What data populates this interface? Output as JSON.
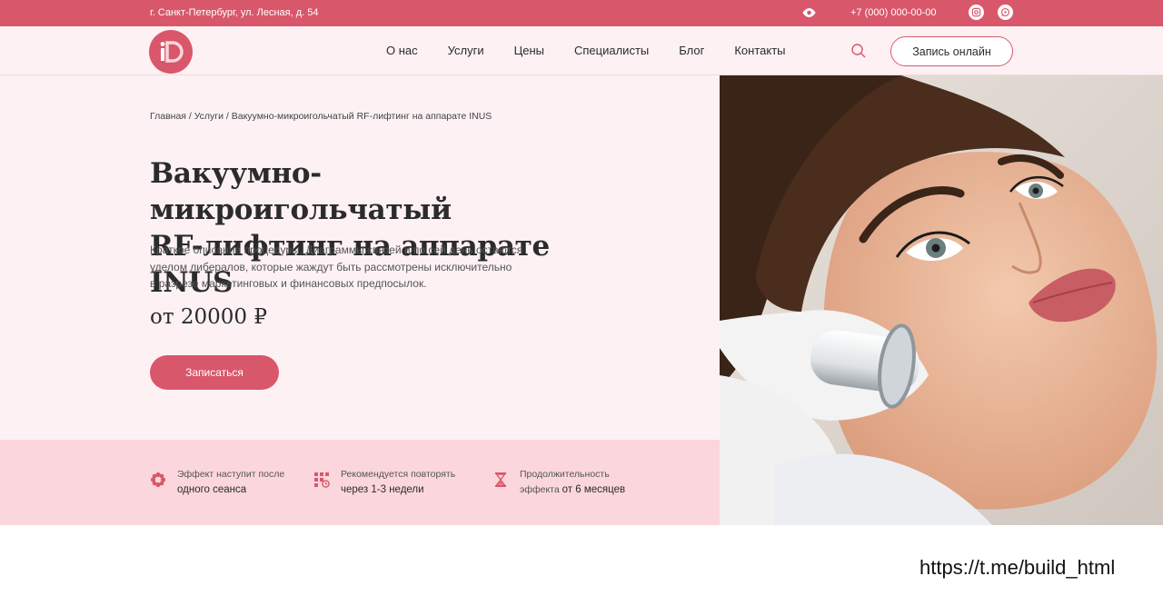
{
  "topbar": {
    "address": "г. Санкт-Петербург, ул. Лесная, д. 54",
    "phone": "+7 (000) 000-00-00",
    "icons": [
      "eye-icon",
      "instagram-icon",
      "whatsapp-icon"
    ]
  },
  "nav": {
    "logo": "iD",
    "items": [
      "О нас",
      "Услуги",
      "Цены",
      "Специалисты",
      "Блог",
      "Контакты"
    ],
    "book_label": "Запись онлайн"
  },
  "hero": {
    "breadcrumb": "Главная / Услуги / Вакуумно-микроигольчатый RF-лифтинг на аппарате INUS",
    "title_line1": "Вакуумно-микроигольчатый",
    "title_line2": "RF-лифтинг на аппарате INUS",
    "desc_line1": "Краткое описание процедуры. Диаграммы связей и по сей день остаются",
    "desc_line2": "уделом либералов, которые жаждут быть рассмотрены исключительно",
    "desc_line3": "в разрезе маркетинговых и финансовых предпосылок.",
    "price": "от 20000 ₽",
    "cta_label": "Записаться"
  },
  "features": [
    {
      "line1": "Эффект наступит после",
      "line2": "одного сеанса",
      "icon": "flower-icon"
    },
    {
      "line1": "Рекомендуется повторять",
      "line2": "через 1-3 недели",
      "icon": "calendar-icon"
    },
    {
      "line1": "Продолжительность",
      "line2_prefix": "эффекта",
      "line2": "от 6 месяцев",
      "icon": "hourglass-icon"
    }
  ],
  "watermark": "https://t.me/build_html",
  "colors": {
    "accent": "#d9576b",
    "light_pink": "#fdf1f4",
    "feature_bg": "#fbd6dd"
  }
}
